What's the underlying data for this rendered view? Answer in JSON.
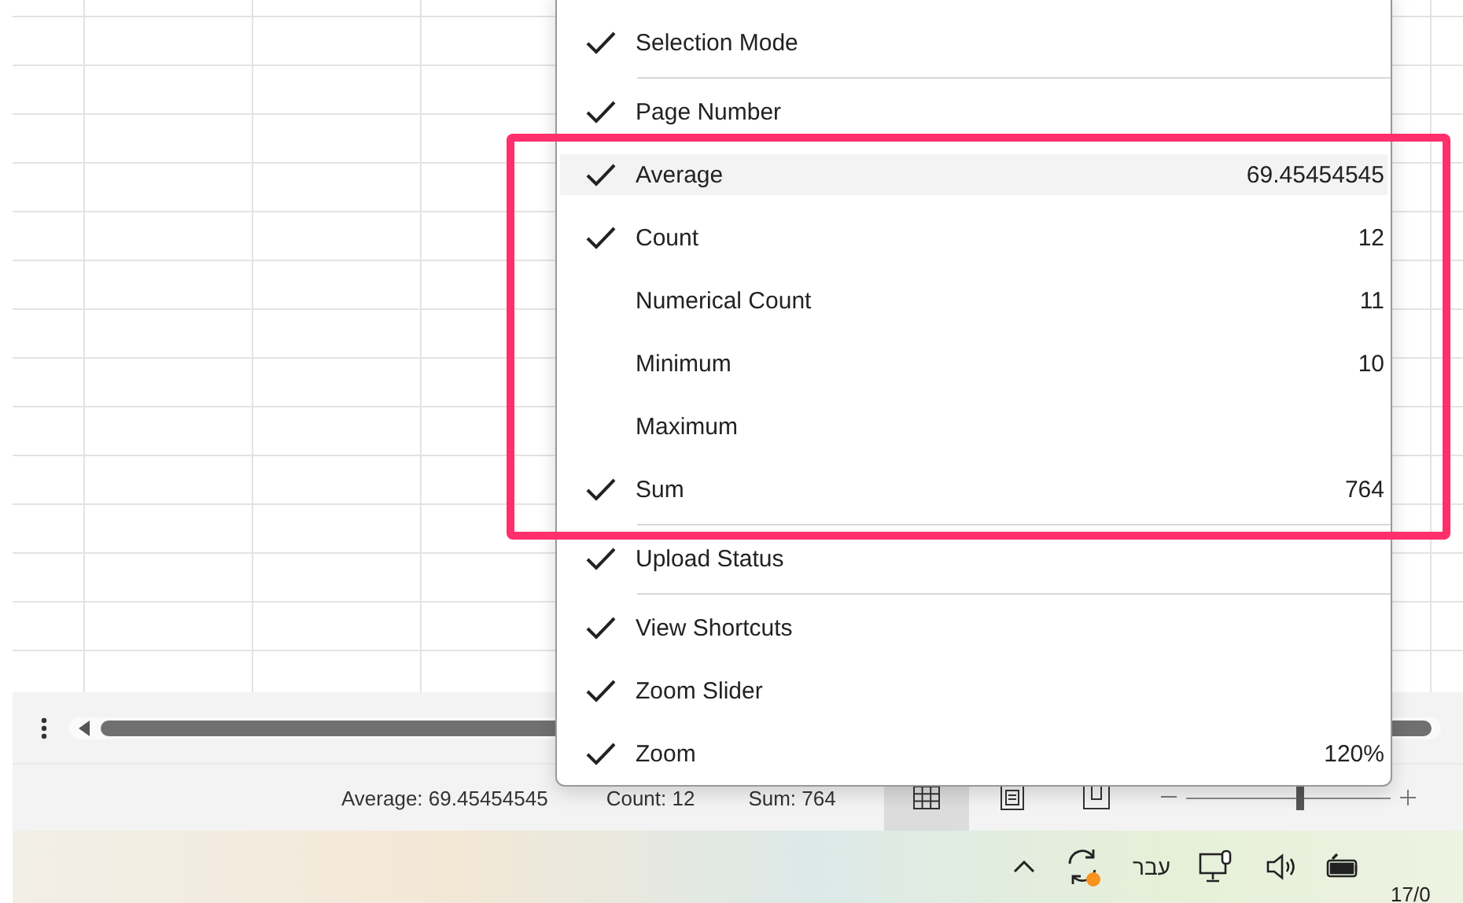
{
  "menu": {
    "items": [
      {
        "label": "Selection Mode",
        "checked": true,
        "highlighted": false,
        "separator_after": true
      },
      {
        "label": "Page Number",
        "checked": true,
        "highlighted": false,
        "separator_after": false
      },
      {
        "label": "Average",
        "value": "69.45454545",
        "checked": true,
        "highlighted": true,
        "separator_after": false
      },
      {
        "label": "Count",
        "value": "12",
        "checked": true,
        "highlighted": false,
        "separator_after": false
      },
      {
        "label": "Numerical Count",
        "value": "11",
        "checked": false,
        "highlighted": false,
        "separator_after": false
      },
      {
        "label": "Minimum",
        "value": "10",
        "checked": false,
        "highlighted": false,
        "separator_after": false
      },
      {
        "label": "Maximum",
        "checked": false,
        "highlighted": false,
        "separator_after": false
      },
      {
        "label": "Sum",
        "value": "764",
        "checked": true,
        "highlighted": false,
        "separator_after": true
      },
      {
        "label": "Upload Status",
        "checked": true,
        "highlighted": false,
        "separator_after": true
      },
      {
        "label": "View Shortcuts",
        "checked": true,
        "highlighted": false,
        "separator_after": false
      },
      {
        "label": "Zoom Slider",
        "checked": true,
        "highlighted": false,
        "separator_after": false
      },
      {
        "label": "Zoom",
        "value": "120%",
        "checked": true,
        "highlighted": false,
        "separator_after": false
      }
    ]
  },
  "status_bar": {
    "stats": [
      "Average: 69.45454545",
      "Count: 12",
      "Sum: 764"
    ],
    "views": [
      {
        "kind": "normal",
        "selected": true
      },
      {
        "kind": "page-layout",
        "selected": false
      },
      {
        "kind": "page-break",
        "selected": false
      }
    ],
    "zoom_slider": {
      "level": 0.55
    }
  },
  "taskbar": {
    "language": "עבר",
    "clock": "17/0"
  }
}
